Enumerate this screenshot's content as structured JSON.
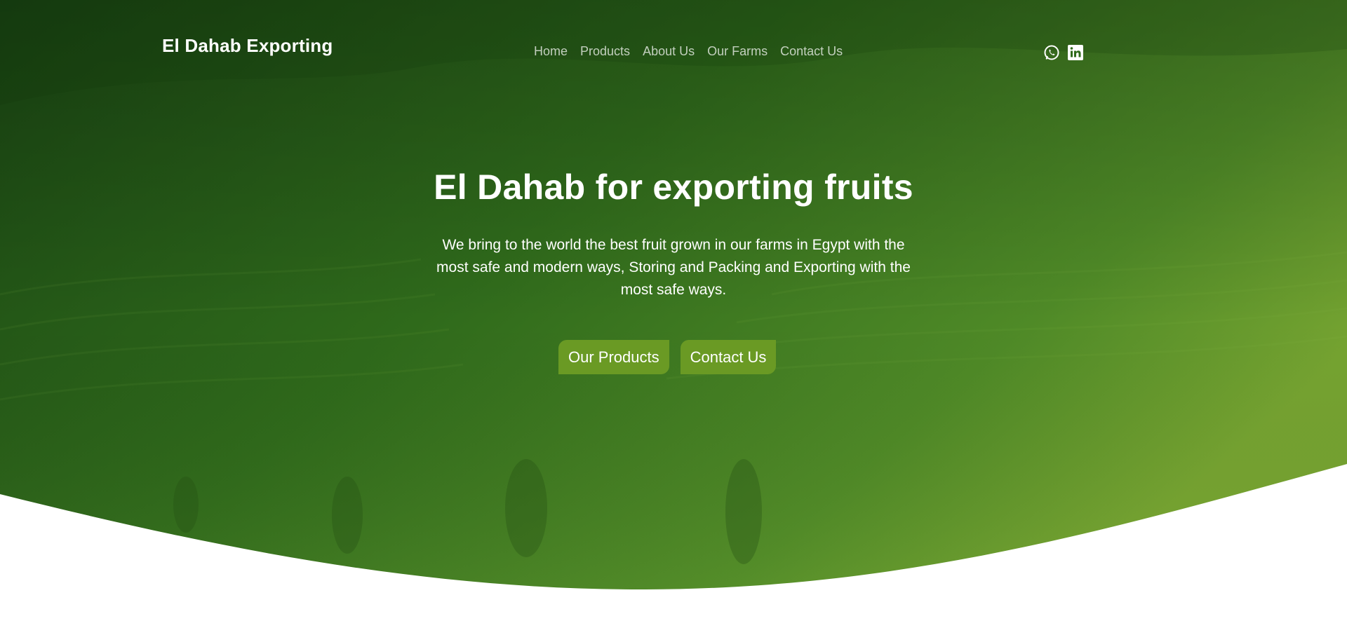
{
  "brand": {
    "name": "El Dahab Exporting"
  },
  "nav": {
    "items": [
      {
        "label": "Home"
      },
      {
        "label": "Products"
      },
      {
        "label": "About Us"
      },
      {
        "label": "Our Farms"
      },
      {
        "label": "Contact Us"
      }
    ]
  },
  "social": {
    "icons": [
      "whatsapp-icon",
      "linkedin-icon"
    ]
  },
  "hero": {
    "title": "El Dahab for exporting fruits",
    "subtitle": "We bring to the world the best fruit grown in our farms in Egypt with the most safe and modern ways, Storing and Packing and Exporting with the most safe ways.",
    "buttons": {
      "primary": "Our Products",
      "secondary": "Contact Us"
    }
  },
  "colors": {
    "dark_green": "#1b4a14",
    "mid_green": "#3f7a22",
    "light_green": "#76a431",
    "button_green": "#6a9a24",
    "background": "#ffffff"
  }
}
